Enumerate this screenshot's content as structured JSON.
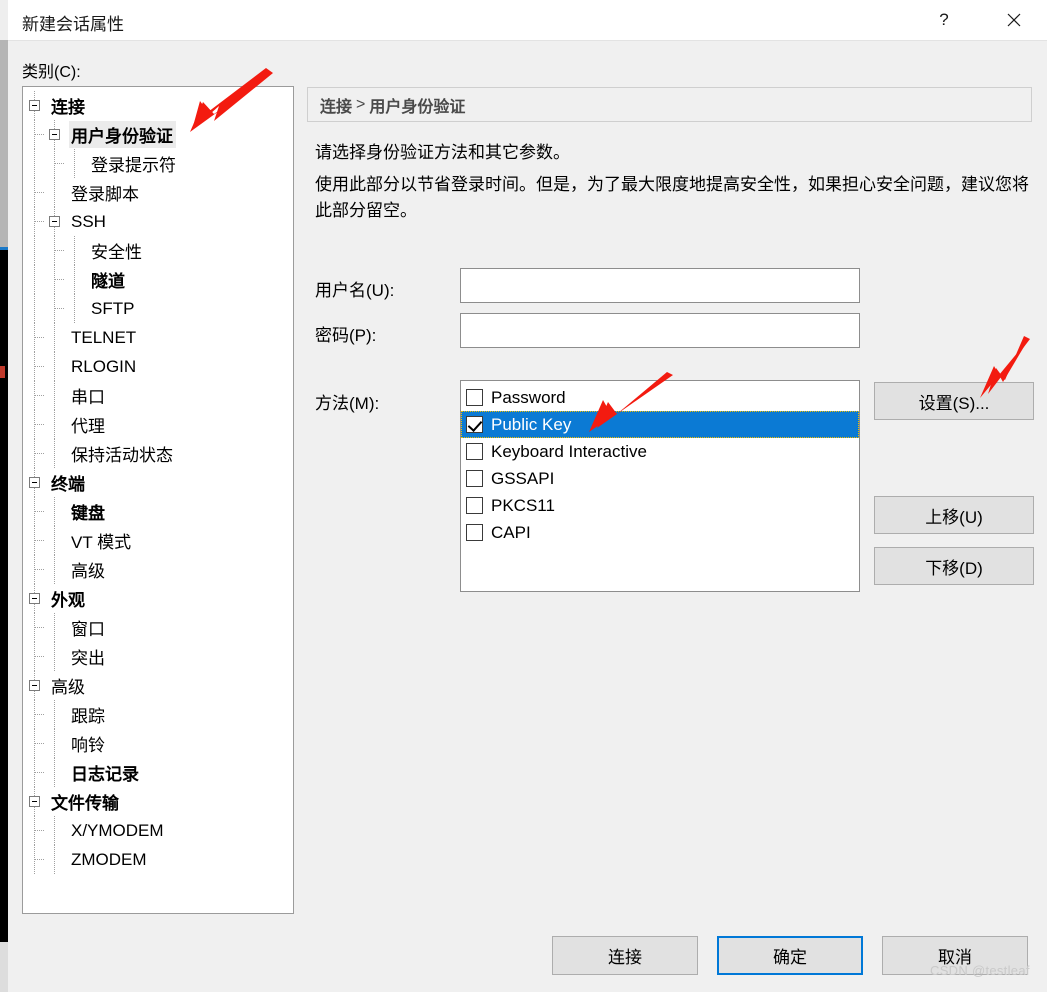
{
  "window": {
    "title": "新建会话属性",
    "help_label": "?",
    "close_label": "✕"
  },
  "category": {
    "label": "类别(C):",
    "tree": [
      {
        "label": "连接",
        "level": 0,
        "bold": true,
        "expandable": true,
        "selected": false
      },
      {
        "label": "用户身份验证",
        "level": 1,
        "bold": true,
        "expandable": true,
        "selected": true
      },
      {
        "label": "登录提示符",
        "level": 2,
        "bold": false,
        "expandable": false,
        "selected": false
      },
      {
        "label": "登录脚本",
        "level": 1,
        "bold": false,
        "expandable": false,
        "selected": false
      },
      {
        "label": "SSH",
        "level": 1,
        "bold": false,
        "expandable": true,
        "selected": false
      },
      {
        "label": "安全性",
        "level": 2,
        "bold": false,
        "expandable": false,
        "selected": false
      },
      {
        "label": "隧道",
        "level": 2,
        "bold": true,
        "expandable": false,
        "selected": false
      },
      {
        "label": "SFTP",
        "level": 2,
        "bold": false,
        "expandable": false,
        "selected": false
      },
      {
        "label": "TELNET",
        "level": 1,
        "bold": false,
        "expandable": false,
        "selected": false
      },
      {
        "label": "RLOGIN",
        "level": 1,
        "bold": false,
        "expandable": false,
        "selected": false
      },
      {
        "label": "串口",
        "level": 1,
        "bold": false,
        "expandable": false,
        "selected": false
      },
      {
        "label": "代理",
        "level": 1,
        "bold": false,
        "expandable": false,
        "selected": false
      },
      {
        "label": "保持活动状态",
        "level": 1,
        "bold": false,
        "expandable": false,
        "selected": false
      },
      {
        "label": "终端",
        "level": 0,
        "bold": true,
        "expandable": true,
        "selected": false
      },
      {
        "label": "键盘",
        "level": 1,
        "bold": true,
        "expandable": false,
        "selected": false
      },
      {
        "label": "VT 模式",
        "level": 1,
        "bold": false,
        "expandable": false,
        "selected": false
      },
      {
        "label": "高级",
        "level": 1,
        "bold": false,
        "expandable": false,
        "selected": false
      },
      {
        "label": "外观",
        "level": 0,
        "bold": true,
        "expandable": true,
        "selected": false
      },
      {
        "label": "窗口",
        "level": 1,
        "bold": false,
        "expandable": false,
        "selected": false
      },
      {
        "label": "突出",
        "level": 1,
        "bold": false,
        "expandable": false,
        "selected": false
      },
      {
        "label": "高级",
        "level": 0,
        "bold": false,
        "expandable": true,
        "selected": false
      },
      {
        "label": "跟踪",
        "level": 1,
        "bold": false,
        "expandable": false,
        "selected": false
      },
      {
        "label": "响铃",
        "level": 1,
        "bold": false,
        "expandable": false,
        "selected": false
      },
      {
        "label": "日志记录",
        "level": 1,
        "bold": true,
        "expandable": false,
        "selected": false
      },
      {
        "label": "文件传输",
        "level": 0,
        "bold": true,
        "expandable": true,
        "selected": false
      },
      {
        "label": "X/YMODEM",
        "level": 1,
        "bold": false,
        "expandable": false,
        "selected": false
      },
      {
        "label": "ZMODEM",
        "level": 1,
        "bold": false,
        "expandable": false,
        "selected": false
      }
    ]
  },
  "pane": {
    "breadcrumb_root": "连接",
    "breadcrumb_sep": ">",
    "breadcrumb_leaf": "用户身份验证",
    "description_line1": "请选择身份验证方法和其它参数。",
    "description_line2": "使用此部分以节省登录时间。但是，为了最大限度地提高安全性，如果担心安全问题，建议您将此部分留空。"
  },
  "form": {
    "username_label": "用户名(U):",
    "username_value": "",
    "username_placeholder": "",
    "password_label": "密码(P):",
    "password_value": "",
    "password_placeholder": "",
    "method_label": "方法(M):",
    "methods": [
      {
        "label": "Password",
        "checked": false,
        "selected": false
      },
      {
        "label": "Public Key",
        "checked": true,
        "selected": true
      },
      {
        "label": "Keyboard Interactive",
        "checked": false,
        "selected": false
      },
      {
        "label": "GSSAPI",
        "checked": false,
        "selected": false
      },
      {
        "label": "PKCS11",
        "checked": false,
        "selected": false
      },
      {
        "label": "CAPI",
        "checked": false,
        "selected": false
      }
    ]
  },
  "side_buttons": {
    "settings": "设置(S)...",
    "move_up": "上移(U)",
    "move_down": "下移(D)"
  },
  "bottom_buttons": {
    "connect": "连接",
    "ok": "确定",
    "cancel": "取消"
  },
  "watermark": "CSDN @testleaf",
  "colors": {
    "selection_blue": "#0b7ad4",
    "accent_focus": "#0078d7",
    "arrow_red": "#f31b10",
    "dialog_bg": "#f0f0f0"
  }
}
